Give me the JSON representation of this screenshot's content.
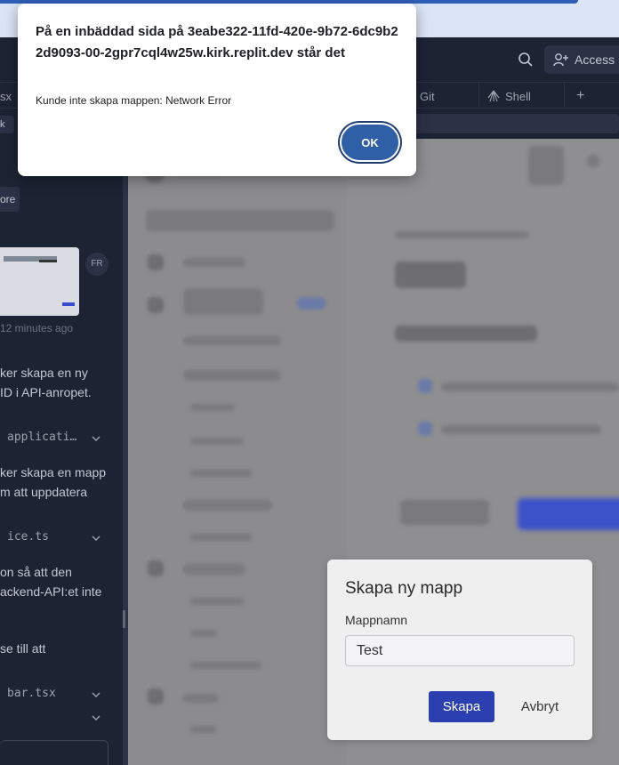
{
  "alert": {
    "title": "På en inbäddad sida på 3eabe322-11fd-420e-9b72-6dc9b22d9093-00-2gpr7cql4w25w.kirk.replit.dev står det",
    "message": "Kunde inte skapa mappen: Network Error",
    "ok_label": "OK"
  },
  "header": {
    "access_label": "Access"
  },
  "tabs": [
    {
      "label": "sx"
    },
    {
      "label": "Git"
    },
    {
      "label": "Shell"
    },
    {
      "label": "+"
    }
  ],
  "address": {
    "chip": "k"
  },
  "chat": {
    "more_label": "ore",
    "avatar_initials": "FR",
    "timestamp": "12 minutes ago",
    "messages": [
      {
        "text": "ker skapa en ny"
      },
      {
        "text": " ID i API-anropet."
      },
      {
        "text": " applicati…"
      },
      {
        "text": "ker skapa en mapp"
      },
      {
        "text": "m att uppdatera"
      },
      {
        "text": "ice.ts"
      },
      {
        "text": "on så att den"
      },
      {
        "text": "ackend-API:et inte"
      },
      {
        "text": "se till att"
      },
      {
        "text": "bar.tsx"
      }
    ]
  },
  "modal": {
    "title": "Skapa ny mapp",
    "field_label": "Mappnamn",
    "field_value": "Test",
    "create_label": "Skapa",
    "cancel_label": "Avbryt"
  }
}
